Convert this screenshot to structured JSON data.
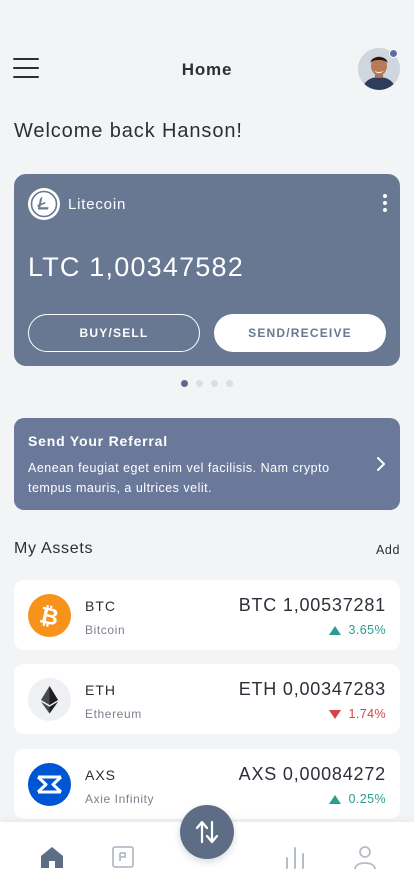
{
  "header": {
    "title": "Home",
    "menu_icon": "hamburger-menu-icon",
    "avatar_status_color": "#5b6fa3"
  },
  "welcome": "Welcome back Hanson!",
  "wallet_card": {
    "coin_name": "Litecoin",
    "coin_icon": "litecoin-icon",
    "balance": "LTC 1,00347582",
    "buy_sell_label": "BUY/SELL",
    "send_receive_label": "SEND/RECEIVE",
    "background": "#687892",
    "carousel": {
      "pages": 4,
      "active": 1
    }
  },
  "referral": {
    "title": "Send Your Referral",
    "text": "Aenean feugiat eget enim vel facilisis. Nam crypto tempus mauris, a ultrices velit."
  },
  "assets": {
    "title": "My Assets",
    "add_label": "Add",
    "items": [
      {
        "symbol": "BTC",
        "name": "Bitcoin",
        "amount": "BTC 1,00537281",
        "change": "3.65%",
        "direction": "up",
        "icon": "bitcoin-icon",
        "color": "#f7931a"
      },
      {
        "symbol": "ETH",
        "name": "Ethereum",
        "amount": "ETH 0,00347283",
        "change": "1.74%",
        "direction": "down",
        "icon": "ethereum-icon",
        "color": "#eef0f3"
      },
      {
        "symbol": "AXS",
        "name": "Axie Infinity",
        "amount": "AXS 0,00084272",
        "change": "0.25%",
        "direction": "up",
        "icon": "axie-infinity-icon",
        "color": "#0055d5"
      }
    ]
  },
  "tabbar": {
    "items": [
      "home-icon",
      "wallet-icon",
      "swap-icon",
      "chart-icon",
      "profile-icon"
    ],
    "active": "home-icon"
  },
  "colors": {
    "up": "#2a9d8f",
    "down": "#d64545",
    "accent": "#5e6d86"
  }
}
